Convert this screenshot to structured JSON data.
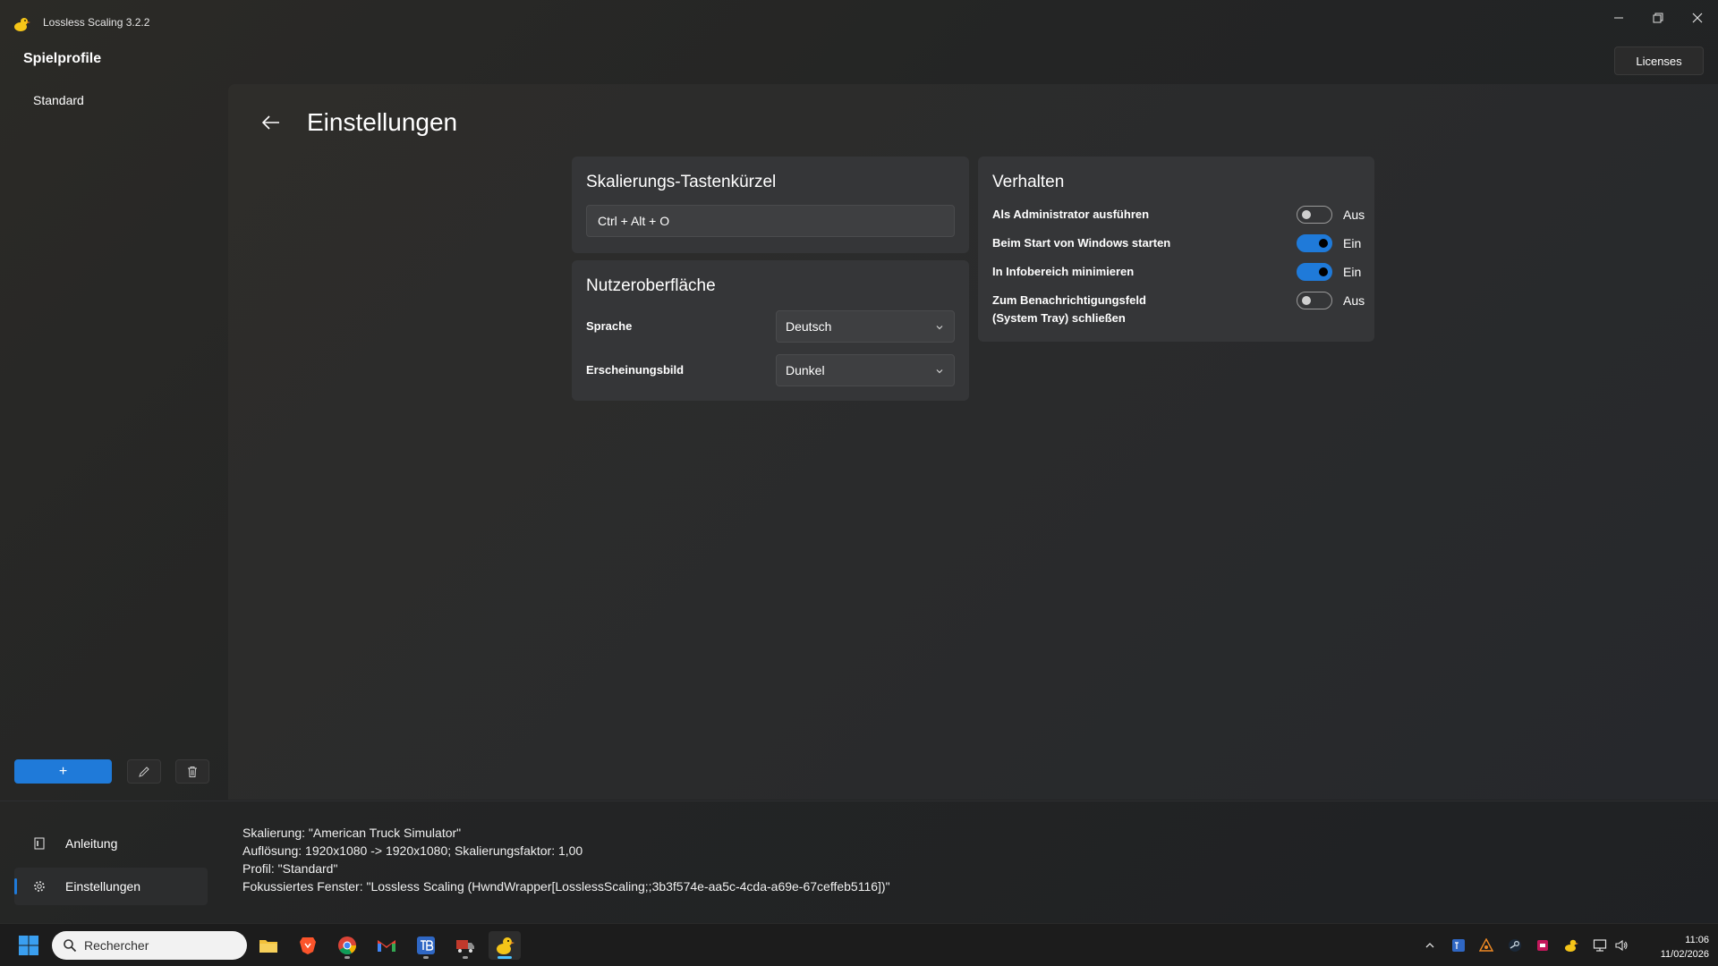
{
  "window": {
    "title": "Lossless Scaling 3.2.2",
    "licenses_label": "Licenses"
  },
  "sidebar": {
    "title": "Spielprofile",
    "profiles": [
      "Standard"
    ],
    "add_label": "+",
    "nav": [
      {
        "label": "Anleitung",
        "icon": "book-icon"
      },
      {
        "label": "Einstellungen",
        "icon": "gear-icon",
        "active": true
      }
    ]
  },
  "main": {
    "title": "Einstellungen",
    "hotkey_card": {
      "title": "Skalierungs-Tastenkürzel",
      "value": "Ctrl + Alt + O"
    },
    "ui_card": {
      "title": "Nutzeroberfläche",
      "rows": [
        {
          "label": "Sprache",
          "value": "Deutsch"
        },
        {
          "label": "Erscheinungsbild",
          "value": "Dunkel"
        }
      ]
    },
    "behavior_card": {
      "title": "Verhalten",
      "rows": [
        {
          "label": "Als Administrator ausführen",
          "state": "Aus",
          "on": false
        },
        {
          "label": "Beim Start von Windows starten",
          "state": "Ein",
          "on": true
        },
        {
          "label": "In Infobereich minimieren",
          "state": "Ein",
          "on": true
        },
        {
          "label": "Zum Benachrichtigungsfeld\n(System Tray) schließen",
          "label_line1": "Zum Benachrichtigungsfeld",
          "label_line2": "(System Tray) schließen",
          "state": "Aus",
          "on": false
        }
      ]
    }
  },
  "status": {
    "lines": [
      "Skalierung: \"American Truck Simulator\"",
      "Auflösung: 1920x1080 -> 1920x1080; Skalierungsfaktor: 1,00",
      "Profil: \"Standard\"",
      "Fokussiertes Fenster: \"Lossless Scaling (HwndWrapper[LosslessScaling;;3b3f574e-aa5c-4cda-a69e-67ceffeb5116])\""
    ]
  },
  "taskbar": {
    "search_placeholder": "Rechercher",
    "time": "11:06",
    "date": "11/02/2026"
  },
  "colors": {
    "accent": "#1f7ad9",
    "card": "#353638",
    "taskbar_indicator": "#4cc2ff"
  }
}
